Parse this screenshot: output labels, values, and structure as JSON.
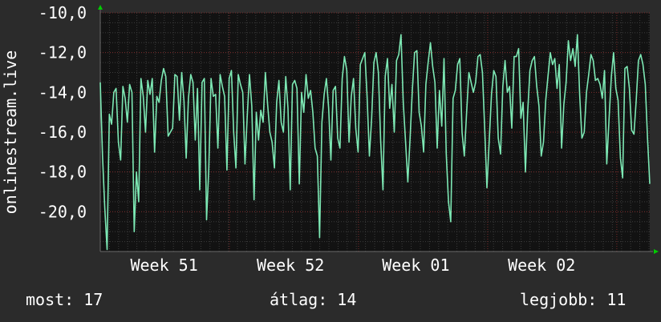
{
  "chart_data": {
    "type": "line",
    "title": "",
    "ylabel": "onlinestream.live",
    "ylim": [
      -22,
      -10
    ],
    "yticks": [
      -10,
      -12,
      -14,
      -16,
      -18,
      -20
    ],
    "ytick_labels": [
      "-10,0",
      "-12,0",
      "-14,0",
      "-16,0",
      "-18,0",
      "-20,0"
    ],
    "xlim": [
      0,
      1
    ],
    "xticks": [
      {
        "label": "Week 51",
        "x": 0.125
      },
      {
        "label": "Week 52",
        "x": 0.355
      },
      {
        "label": "Week 01",
        "x": 0.583
      },
      {
        "label": "Week 02",
        "x": 0.812
      }
    ],
    "grid": true,
    "series": [
      {
        "color": "#7de8b4",
        "values": [
          -13.5,
          -17.2,
          -19.8,
          -21.9,
          -15.1,
          -15.6,
          -14.0,
          -13.8,
          -16.5,
          -17.4,
          -13.7,
          -14.3,
          -15.5,
          -13.6,
          -14.0,
          -21.0,
          -18.0,
          -19.5,
          -13.3,
          -14.2,
          -16.0,
          -13.4,
          -14.1,
          -13.3,
          -17.0,
          -14.2,
          -14.5,
          -13.4,
          -12.8,
          -13.2,
          -16.2,
          -16.0,
          -15.8,
          -13.1,
          -13.2,
          -15.4,
          -13.0,
          -14.4,
          -17.3,
          -14.3,
          -13.1,
          -13.5,
          -16.4,
          -13.8,
          -18.9,
          -13.5,
          -13.3,
          -20.4,
          -17.8,
          -13.3,
          -14.2,
          -14.1,
          -16.8,
          -13.1,
          -13.7,
          -14.2,
          -17.9,
          -13.3,
          -12.9,
          -16.0,
          -17.8,
          -13.1,
          -13.6,
          -14.0,
          -17.6,
          -15.2,
          -13.1,
          -14.7,
          -19.4,
          -15.0,
          -16.4,
          -14.9,
          -15.5,
          -13.0,
          -14.6,
          -16.0,
          -16.5,
          -17.8,
          -14.5,
          -13.4,
          -15.5,
          -16.0,
          -13.2,
          -14.8,
          -18.9,
          -13.6,
          -13.4,
          -13.8,
          -18.6,
          -14.0,
          -15.0,
          -13.1,
          -14.3,
          -13.9,
          -15.0,
          -16.8,
          -17.2,
          -21.3,
          -15.5,
          -14.1,
          -13.3,
          -14.8,
          -17.4,
          -13.9,
          -13.7,
          -16.3,
          -16.8,
          -13.3,
          -12.2,
          -12.9,
          -16.5,
          -14.2,
          -13.3,
          -15.8,
          -17.0,
          -12.6,
          -12.3,
          -12.0,
          -14.2,
          -17.2,
          -15.3,
          -12.5,
          -12.0,
          -13.0,
          -16.4,
          -18.9,
          -13.2,
          -12.3,
          -14.8,
          -13.6,
          -16.0,
          -12.4,
          -12.1,
          -11.1,
          -14.5,
          -16.5,
          -18.5,
          -16.3,
          -13.9,
          -12.0,
          -11.9,
          -15.0,
          -15.7,
          -17.0,
          -13.6,
          -12.5,
          -11.5,
          -12.7,
          -13.5,
          -16.8,
          -13.9,
          -15.7,
          -12.3,
          -17.1,
          -19.5,
          -20.5,
          -14.3,
          -13.9,
          -12.6,
          -12.3,
          -16.0,
          -17.2,
          -15.0,
          -13.0,
          -13.5,
          -14.0,
          -13.5,
          -12.2,
          -12.1,
          -13.0,
          -15.8,
          -18.8,
          -16.4,
          -14.1,
          -12.9,
          -13.2,
          -16.3,
          -17.1,
          -13.7,
          -12.4,
          -14.0,
          -13.7,
          -15.8,
          -12.2,
          -12.2,
          -11.8,
          -15.3,
          -14.5,
          -18.0,
          -15.0,
          -12.9,
          -12.4,
          -12.2,
          -13.7,
          -14.7,
          -17.2,
          -16.5,
          -14.4,
          -13.2,
          -12.0,
          -12.6,
          -12.3,
          -13.8,
          -12.6,
          -16.8,
          -14.6,
          -13.5,
          -11.4,
          -12.4,
          -11.8,
          -12.7,
          -11.1,
          -14.1,
          -16.3,
          -16.0,
          -14.0,
          -13.1,
          -12.1,
          -12.4,
          -13.4,
          -13.3,
          -13.6,
          -14.3,
          -12.9,
          -17.6,
          -15.3,
          -13.2,
          -12.0,
          -13.8,
          -14.4,
          -17.3,
          -18.3,
          -12.8,
          -12.7,
          -13.8,
          -15.9,
          -16.1,
          -14.4,
          -12.4,
          -12.1,
          -12.6,
          -13.6,
          -16.3,
          -18.6
        ]
      }
    ],
    "stats": {
      "current_label": "most:",
      "current_value": "17",
      "average_label": "átlag:",
      "average_value": "14",
      "best_label": "legjobb:",
      "best_value": "11"
    }
  },
  "colors": {
    "background": "#2b2b2b",
    "plot_background": "#121212",
    "grid_major": "#7a2a2a",
    "grid_minor": "#3c3c3c",
    "axis": "#6a6a6a",
    "arrow": "#00cc00",
    "text": "#ffffff"
  }
}
